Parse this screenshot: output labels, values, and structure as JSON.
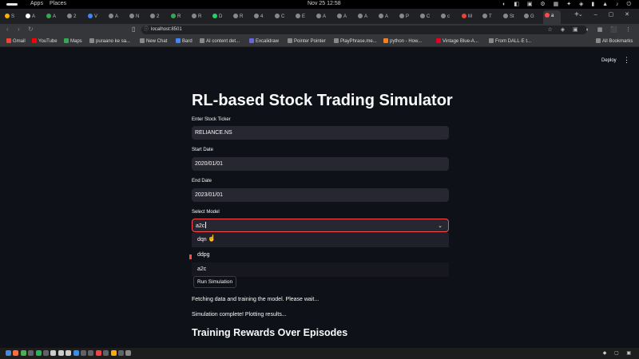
{
  "os": {
    "apps": "Apps",
    "places": "Places",
    "clock": "Nov 25  12:58",
    "tray_icons": "◐ ◧ ▣ ⚙ ▦ ✦ ◈ ▮ ▲ ♪ ⏻"
  },
  "browser": {
    "tabs": [
      {
        "label": "S",
        "color": "#f5b400"
      },
      {
        "label": "A",
        "color": "#ffffff"
      },
      {
        "label": "A",
        "color": "#34a853"
      },
      {
        "label": "2",
        "color": "#888888"
      },
      {
        "label": "V",
        "color": "#4285f4"
      },
      {
        "label": "A",
        "color": "#888888"
      },
      {
        "label": "N",
        "color": "#888888"
      },
      {
        "label": "2",
        "color": "#888888"
      },
      {
        "label": "R",
        "color": "#34a853"
      },
      {
        "label": "R",
        "color": "#888888"
      },
      {
        "label": "D",
        "color": "#25d366"
      },
      {
        "label": "R",
        "color": "#888888"
      },
      {
        "label": "4",
        "color": "#888888"
      },
      {
        "label": "C",
        "color": "#888888"
      },
      {
        "label": "E",
        "color": "#888888"
      },
      {
        "label": "A",
        "color": "#888888"
      },
      {
        "label": "A",
        "color": "#888888"
      },
      {
        "label": "A",
        "color": "#888888"
      },
      {
        "label": "A",
        "color": "#888888"
      },
      {
        "label": "P",
        "color": "#888888"
      },
      {
        "label": "C",
        "color": "#888888"
      },
      {
        "label": "c",
        "color": "#888888"
      },
      {
        "label": "M",
        "color": "#ea4335"
      },
      {
        "label": "T",
        "color": "#888888"
      },
      {
        "label": "St",
        "color": "#888888"
      },
      {
        "label": "G",
        "color": "#888888"
      },
      {
        "label": "a",
        "color": "#ff4b4b"
      }
    ],
    "new_tab": "+",
    "url": "localhost:8501",
    "window_controls": "⌄ – ▢ ✕",
    "extensions": "☆ ◈ ▣ ◐ ▦ ⬛ ⋮"
  },
  "bookmarks": [
    {
      "label": "Gmail",
      "color": "#ea4335"
    },
    {
      "label": "YouTube",
      "color": "#ff0000"
    },
    {
      "label": "Maps",
      "color": "#34a853"
    },
    {
      "label": "puraano ke sa...",
      "color": "#888888"
    },
    {
      "label": "New Chat",
      "color": "#888888"
    },
    {
      "label": "Bard",
      "color": "#4285f4"
    },
    {
      "label": "AI content det...",
      "color": "#888888"
    },
    {
      "label": "Excalidraw",
      "color": "#6965db"
    },
    {
      "label": "Pointer Pointer",
      "color": "#888888"
    },
    {
      "label": "PlayPhrase.me...",
      "color": "#888888"
    },
    {
      "label": "python - How...",
      "color": "#f48024"
    },
    {
      "label": "Vintage Blue-A...",
      "color": "#e60023"
    },
    {
      "label": "From DALL·E t...",
      "color": "#888888"
    },
    {
      "label": "All Bookmarks",
      "color": "#888888"
    }
  ],
  "app": {
    "deploy": "Deploy",
    "menu": "⋮",
    "title": "RL-based Stock Trading Simulator",
    "ticker_label": "Enter Stock Ticker",
    "ticker_value": "RELIANCE.NS",
    "start_label": "Start Date",
    "start_value": "2020/01/01",
    "end_label": "End Date",
    "end_value": "2023/01/01",
    "model_label": "Select Model",
    "model_value": "a2c",
    "model_options": [
      "dqn",
      "ddpg",
      "a2c"
    ],
    "run_button": "Run Simulation",
    "status_fetching": "Fetching data and training the model. Please wait...",
    "status_complete": "Simulation complete! Plotting results...",
    "section_title": "Training Rewards Over Episodes"
  },
  "taskbar": {
    "icons": [
      "#3a8ee6",
      "#ff6d3b",
      "#4caf50",
      "#5f6368",
      "#1db954",
      "#5f6368",
      "#cccccc",
      "#cccccc",
      "#cccccc",
      "#3a8ee6",
      "#5f6368",
      "#5f6368",
      "#e44",
      "#5f6368",
      "#ffaa00",
      "#5f6368",
      "#888888"
    ],
    "right": "◆ ▢ ▣"
  }
}
